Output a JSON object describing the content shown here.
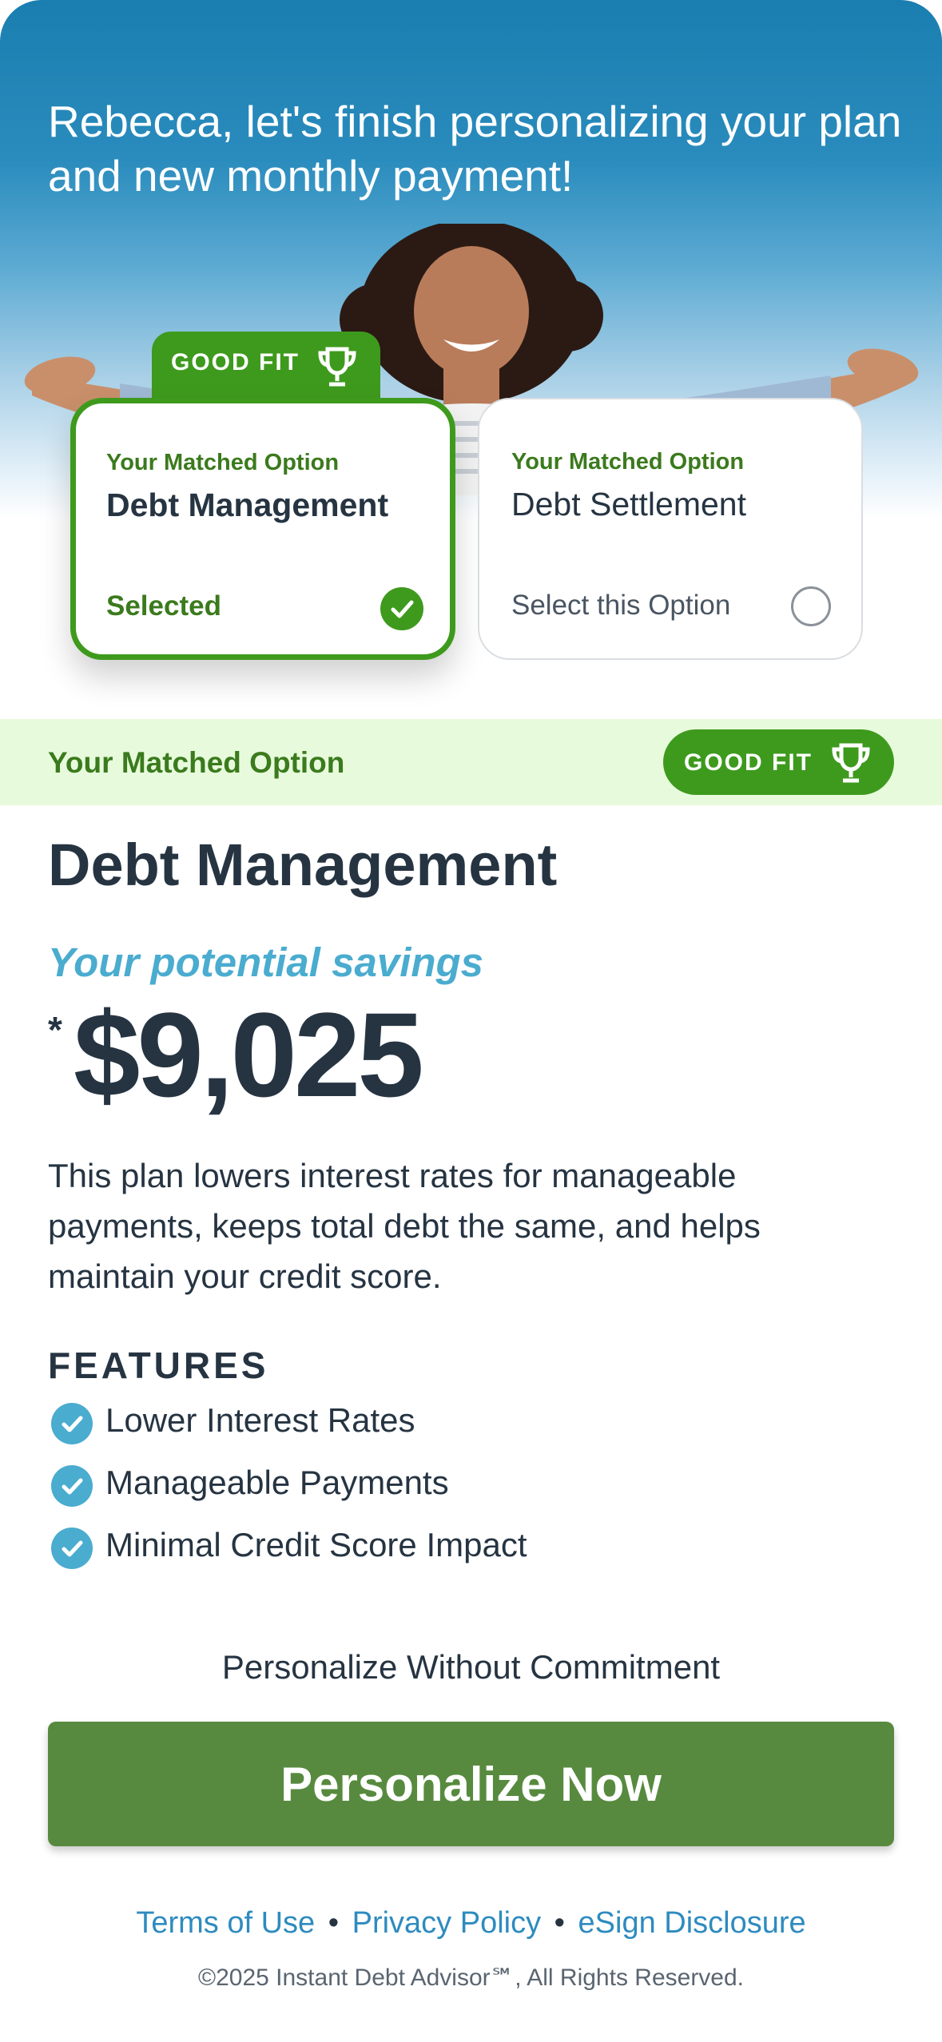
{
  "hero": {
    "title": "Rebecca, let's finish personalizing your plan and new monthly payment!"
  },
  "good_fit_badge": {
    "label": "GOOD FIT",
    "icon": "trophy-icon"
  },
  "options": [
    {
      "sub_label": "Your Matched Option",
      "title": "Debt Management",
      "status": "Selected",
      "selected": true
    },
    {
      "sub_label": "Your Matched Option",
      "title": "Debt Settlement",
      "status": "Select this Option",
      "selected": false
    }
  ],
  "match_strip": {
    "label": "Your Matched Option",
    "badge_label": "GOOD FIT"
  },
  "plan": {
    "title": "Debt Management",
    "savings_label": "Your potential savings",
    "asterisk": "*",
    "savings_amount": "$9,025",
    "description": "This plan lowers interest rates for manageable payments, keeps total debt the same, and helps maintain your credit score."
  },
  "features": {
    "heading": "FEATURES",
    "items": [
      "Lower Interest Rates",
      "Manageable Payments",
      "Minimal Credit Score Impact"
    ]
  },
  "cta": {
    "note": "Personalize Without Commitment",
    "button_label": "Personalize Now"
  },
  "footer": {
    "links": [
      "Terms of Use",
      "Privacy Policy",
      "eSign Disclosure"
    ],
    "separator": "•",
    "copyright": "©2025 Instant Debt Advisor℠, All Rights Reserved."
  },
  "colors": {
    "green_primary": "#3e9a1d",
    "green_text": "#3b7a1d",
    "green_strip": "#e7fbdc",
    "cta_green": "#578a3e",
    "accent_blue": "#4aaccf",
    "link_blue": "#2e8bbf",
    "hero_blue": "#1a7eb0",
    "text_dark": "#263442"
  }
}
